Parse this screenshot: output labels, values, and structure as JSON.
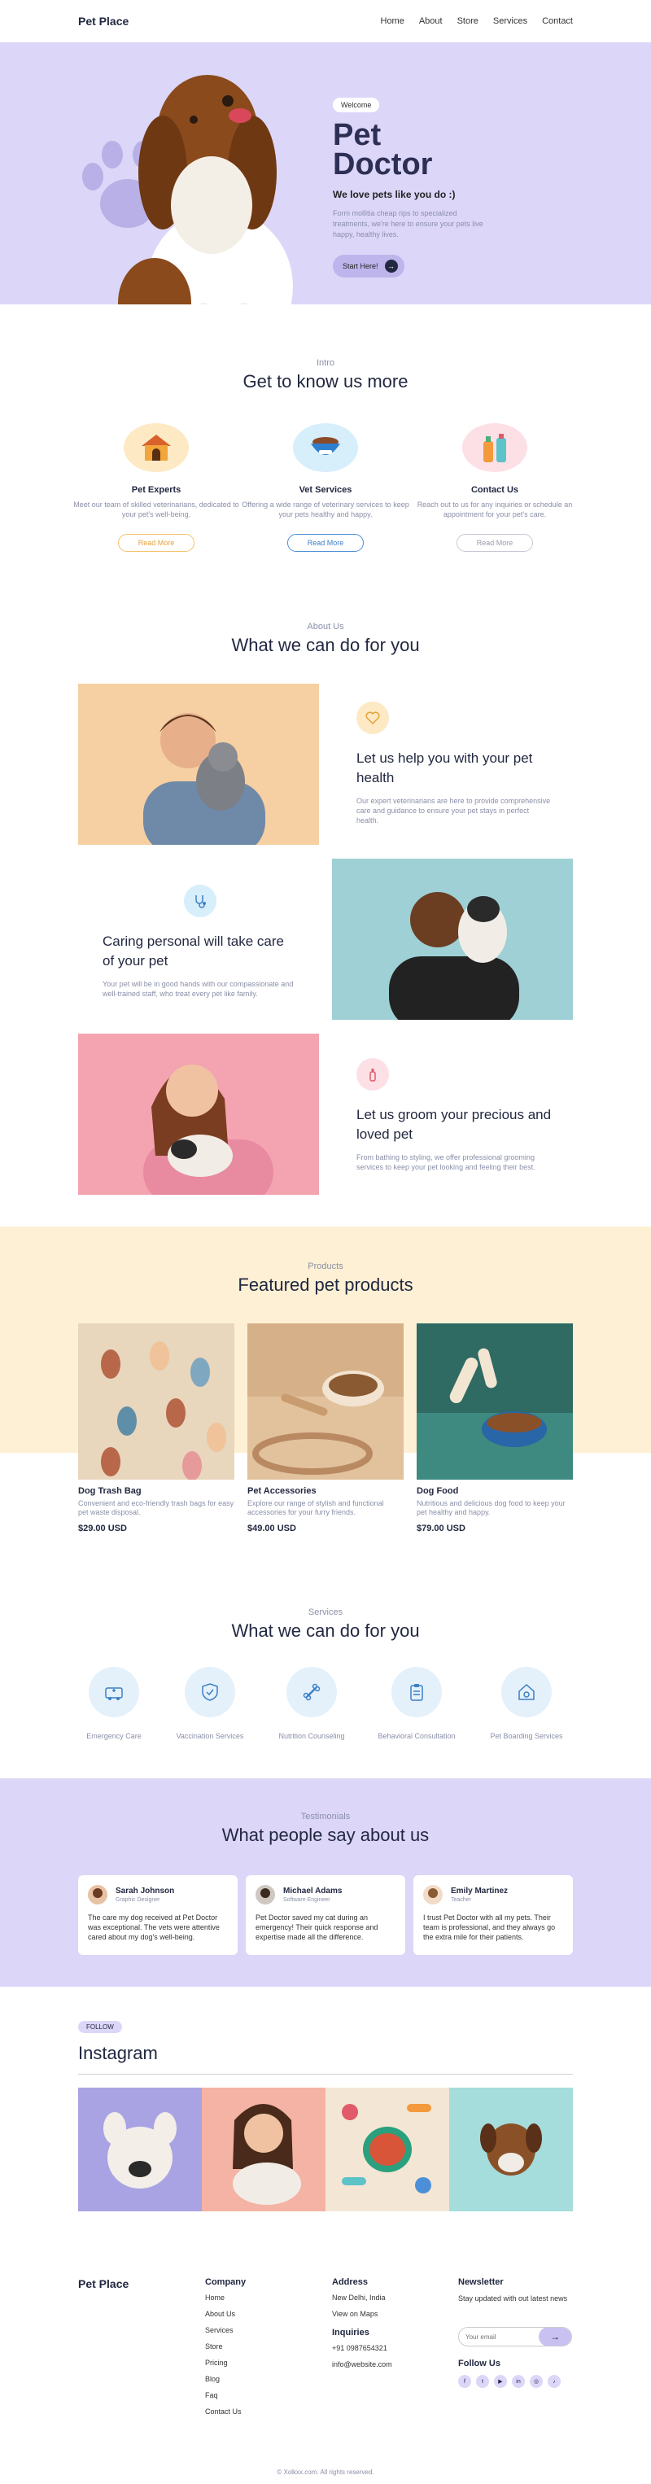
{
  "header": {
    "logo": "Pet Place",
    "nav": [
      "Home",
      "About",
      "Store",
      "Services",
      "Contact"
    ]
  },
  "hero": {
    "badge": "Welcome",
    "title_line1": "Pet",
    "title_line2": "Doctor",
    "tagline": "We love pets like you do :)",
    "subtitle": "Form mollitia cheap rips to specialized treatments, we're here to ensure your pets live happy, healthy lives.",
    "cta": "Start Here!"
  },
  "intro": {
    "eyebrow": "Intro",
    "title": "Get to know us more",
    "cards": [
      {
        "title": "Pet Experts",
        "desc": "Meet our team of skilled veterinarians, dedicated to your pet's well-being.",
        "button": "Read More",
        "color": "#f5c26b"
      },
      {
        "title": "Vet Services",
        "desc": "Offering a wide range of veterinary services to keep your pets healthy and happy.",
        "button": "Read More",
        "color": "#4c8fd8"
      },
      {
        "title": "Contact Us",
        "desc": "Reach out to us for any inquiries or schedule an appointment for your pet's care.",
        "button": "Read More",
        "color": "#c8c8d4"
      }
    ]
  },
  "about": {
    "eyebrow": "About Us",
    "title": "What we can do for you",
    "rows": [
      {
        "title": "Let us help you with your pet health",
        "desc": "Our expert veterinarians are here to provide comprehensive care and guidance to ensure your pet stays in perfect health."
      },
      {
        "title": "Caring personal will take care of your pet",
        "desc": "Your pet will be in good hands with our compassionate and well-trained staff, who treat every pet like family."
      },
      {
        "title": "Let us groom your precious and loved pet",
        "desc": "From bathing to styling, we offer professional grooming services to keep your pet looking and feeling their best."
      }
    ]
  },
  "products": {
    "eyebrow": "Products",
    "title": "Featured pet products",
    "items": [
      {
        "name": "Dog Trash Bag",
        "desc": "Convenient and eco-friendly trash bags for easy pet waste disposal.",
        "price": "$29.00 USD"
      },
      {
        "name": "Pet Accessories",
        "desc": "Explore our range of stylish and functional accessories for your furry friends.",
        "price": "$49.00 USD"
      },
      {
        "name": "Dog Food",
        "desc": "Nutritious and delicious dog food to keep your pet healthy and happy.",
        "price": "$79.00 USD"
      }
    ]
  },
  "services": {
    "eyebrow": "Services",
    "title": "What we can do for you",
    "items": [
      "Emergency Care",
      "Vaccination Services",
      "Nutrition Counseling",
      "Behavioral Consultation",
      "Pet Boarding Services"
    ]
  },
  "testimonials": {
    "eyebrow": "Testimonials",
    "title": "What people say about us",
    "items": [
      {
        "name": "Sarah Johnson",
        "role": "Graphic Designer",
        "quote": "The care my dog received at Pet Doctor was exceptional. The vets were attentive cared about my dog's well-being."
      },
      {
        "name": "Michael Adams",
        "role": "Software Engineer",
        "quote": "Pet Doctor saved my cat during an emergency! Their quick response and expertise made all the difference."
      },
      {
        "name": "Emily Martinez",
        "role": "Teacher",
        "quote": "I trust Pet Doctor with all my pets. Their team is professional, and they always go the extra mile for their patients."
      }
    ]
  },
  "instagram": {
    "badge": "FOLLOW",
    "title": "Instagram"
  },
  "footer": {
    "logo": "Pet Place",
    "company": {
      "heading": "Company",
      "links": [
        "Home",
        "About Us",
        "Services",
        "Store",
        "Pricing",
        "Blog",
        "Faq",
        "Contact Us"
      ]
    },
    "address": {
      "heading": "Address",
      "lines": [
        "New Delhi, India",
        "View on Maps"
      ]
    },
    "inquiries": {
      "heading": "Inquiries",
      "lines": [
        "+91 0987654321",
        "info@website.com"
      ]
    },
    "newsletter": {
      "heading": "Newsletter",
      "text": "Stay updated with out latest news",
      "placeholder": "Your email"
    },
    "follow": {
      "heading": "Follow Us"
    },
    "copyright": "© Xolkxx.com. All rights reserved."
  }
}
